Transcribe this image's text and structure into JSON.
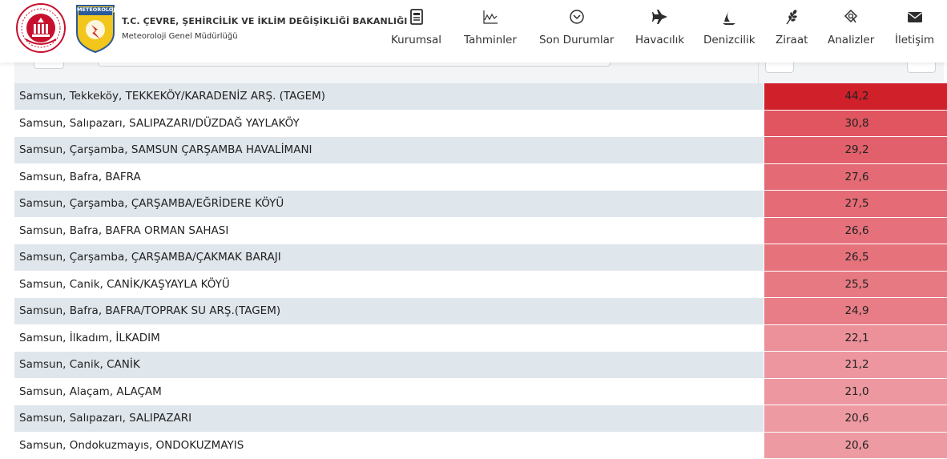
{
  "header": {
    "org_title": "T.C. ÇEVRE, ŞEHİRCİLİK VE İKLİM DEĞİŞİKLİĞİ BAKANLIĞI",
    "org_subtitle": "Meteoroloji Genel Müdürlüğü",
    "mgm_logo_text": "METEOROLOJİ",
    "ministry_logo_icon": "ministry-seal-icon"
  },
  "nav": {
    "items": [
      {
        "label": "Kurumsal",
        "icon": "document-icon"
      },
      {
        "label": "Tahminler",
        "icon": "chart-line-icon"
      },
      {
        "label": "Son Durumlar",
        "icon": "circle-chevron-down-icon"
      },
      {
        "label": "Havacılık",
        "icon": "airplane-icon"
      },
      {
        "label": "Denizcilik",
        "icon": "sailboat-icon"
      },
      {
        "label": "Ziraat",
        "icon": "wheat-icon"
      },
      {
        "label": "Analizler",
        "icon": "analysis-icon"
      },
      {
        "label": "İletişim",
        "icon": "envelope-icon"
      }
    ]
  },
  "colors": {
    "max_value_cell": "#d0202a",
    "high_value_cell": "#e05560",
    "low_value_cell": "#ee9aa3",
    "row_stripe": "#dfe6ec"
  },
  "table": {
    "rows": [
      {
        "station": "Samsun, Tekkeköy, TEKKEKÖY/KARADENİZ ARŞ. (TAGEM)",
        "value": "44,2"
      },
      {
        "station": "Samsun, Salıpazarı, SALIPAZARI/DÜZDAĞ YAYLAKÖY",
        "value": "30,8"
      },
      {
        "station": "Samsun, Çarşamba, SAMSUN ÇARŞAMBA HAVALİMANI",
        "value": "29,2"
      },
      {
        "station": "Samsun, Bafra, BAFRA",
        "value": "27,6"
      },
      {
        "station": "Samsun, Çarşamba, ÇARŞAMBA/EĞRİDERE KÖYÜ",
        "value": "27,5"
      },
      {
        "station": "Samsun, Bafra, BAFRA ORMAN SAHASI",
        "value": "26,6"
      },
      {
        "station": "Samsun, Çarşamba, ÇARŞAMBA/ÇAKMAK BARAJI",
        "value": "26,5"
      },
      {
        "station": "Samsun, Canik, CANİK/KAŞYAYLA KÖYÜ",
        "value": "25,5"
      },
      {
        "station": "Samsun, Bafra, BAFRA/TOPRAK SU ARŞ.(TAGEM)",
        "value": "24,9"
      },
      {
        "station": "Samsun, İlkadım, İLKADIM",
        "value": "22,1"
      },
      {
        "station": "Samsun, Canik, CANİK",
        "value": "21,2"
      },
      {
        "station": "Samsun, Alaçam, ALAÇAM",
        "value": "21,0"
      },
      {
        "station": "Samsun, Salıpazarı, SALIPAZARI",
        "value": "20,6"
      },
      {
        "station": "Samsun, Ondokuzmayıs, ONDOKUZMAYIS",
        "value": "20,6"
      }
    ]
  }
}
